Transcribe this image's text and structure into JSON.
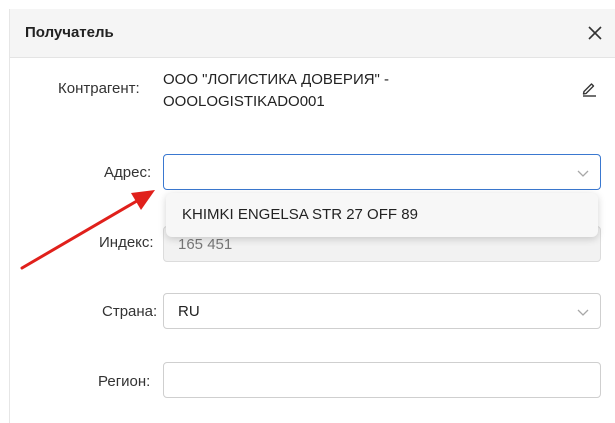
{
  "header": {
    "title": "Получатель",
    "close_icon": "close-icon"
  },
  "fields": {
    "contragent": {
      "label": "Контрагент:",
      "value_line1": "ООО \"ЛОГИСТИКА ДОВЕРИЯ\" -",
      "value_line2": "OOOLOGISTIKADO001",
      "edit_icon": "pencil-icon"
    },
    "address": {
      "label": "Адрес:",
      "value": "",
      "dropdown_option": "KHIMKI ENGELSA STR 27 OFF 89"
    },
    "index": {
      "label": "Индекс:",
      "value": "165 451"
    },
    "country": {
      "label": "Страна:",
      "value": "RU"
    },
    "region": {
      "label": "Регион:",
      "value": ""
    }
  },
  "annotation": {
    "arrow_color": "#e0201b"
  },
  "colors": {
    "focus_border": "#3a78d0",
    "header_bg": "#f5f5f5"
  }
}
